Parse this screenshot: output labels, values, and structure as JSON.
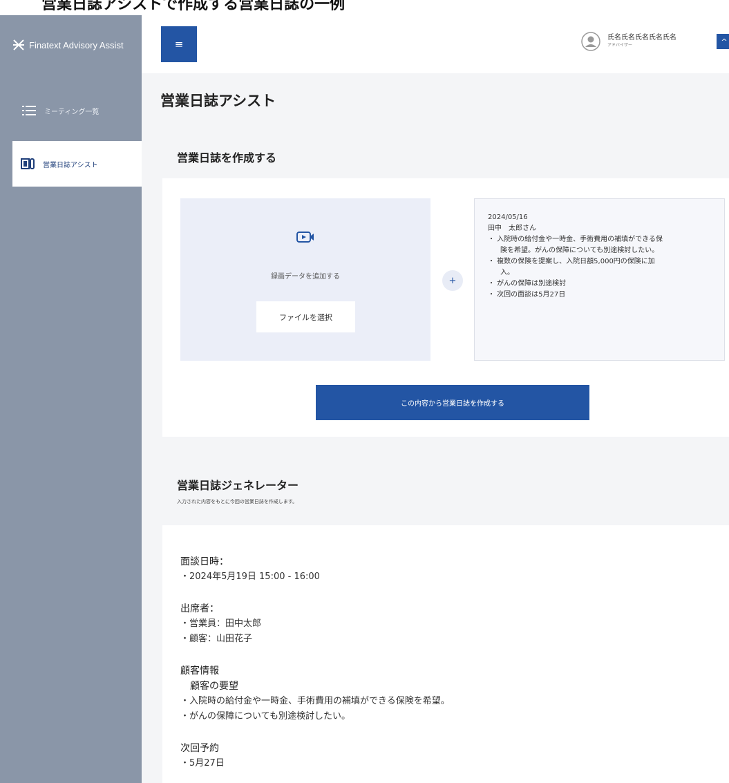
{
  "app": {
    "brand": "Finatext Advisory Assist"
  },
  "top_cut_text": "営業日誌アシストで作成する営業日誌の一例",
  "sidebar": {
    "items": [
      {
        "label": "ミーティング一覧",
        "icon": "list-icon"
      },
      {
        "label": "営業日誌アシスト",
        "icon": "journal-icon",
        "active": true
      }
    ]
  },
  "header": {
    "menu_icon": "≡",
    "user_name": "氏名氏名氏名氏名氏名",
    "user_role": "アドバイザー",
    "caret_icon": "^"
  },
  "page": {
    "title": "営業日誌アシスト"
  },
  "create_section": {
    "title": "営業日誌を作成する",
    "upload_label": "録画データを追加する",
    "file_button": "ファイルを選択",
    "plus": "+",
    "memo": {
      "date": "2024/05/16",
      "customer": "田中　太郎さん",
      "bullets": [
        {
          "text": "・ 入院時の給付金や一時金、手術費用の補填ができる保",
          "cont": "険を希望。がんの保障についても別途検討したい。"
        },
        {
          "text": "・ 複数の保険を提案し、入院日額5,000円の保険に加",
          "cont": "入。"
        },
        {
          "text": "・ がんの保障は別途検討",
          "cont": ""
        },
        {
          "text": "・ 次回の面談は5月27日",
          "cont": ""
        }
      ]
    },
    "create_button": "この内容から営業日誌を作成する"
  },
  "generator_section": {
    "title": "営業日誌ジェネレーター",
    "subtitle": "入力された内容をもとに今回の営業日誌を作成します。",
    "result": {
      "meeting_heading": "面談日時：",
      "meeting_items": [
        "・2024年5月19日 15:00 - 16:00"
      ],
      "attendees_heading": "出席者：",
      "attendees_items": [
        "・営業員：田中太郎",
        "・顧客：山田花子"
      ],
      "customer_heading": "顧客情報",
      "customer_sub": "顧客の要望",
      "customer_items": [
        "・入院時の給付金や一時金、手術費用の補填ができる保険を希望。",
        "・がんの保障についても別途検討したい。"
      ],
      "next_heading": "次回予約",
      "next_items": [
        "・5月27日"
      ]
    }
  },
  "colors": {
    "sidebar": "#8a96a8",
    "accent": "#2355a4",
    "upload_bg": "#ebeef8"
  }
}
